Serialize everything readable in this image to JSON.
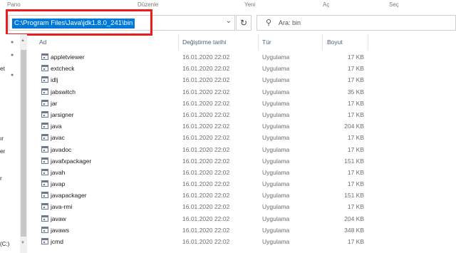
{
  "ribbon": {
    "pane": "Pano",
    "organize": "Düzenle",
    "new": "Yeni",
    "open": "Aç",
    "select": "Seç"
  },
  "address": {
    "path": "C:\\Program Files\\Java\\jdk1.8.0_241\\bin"
  },
  "search": {
    "placeholder": "Ara: bin"
  },
  "left_pane": {
    "labels": [
      "et",
      "ır",
      "er",
      "r",
      "(C:)"
    ]
  },
  "columns": {
    "name": "Ad",
    "date": "Değiştirme tarihi",
    "type": "Tür",
    "size": "Boyut"
  },
  "files": [
    {
      "name": "appletviewer",
      "date": "16.01.2020 22:02",
      "type": "Uygulama",
      "size": "17 KB"
    },
    {
      "name": "extcheck",
      "date": "16.01.2020 22:02",
      "type": "Uygulama",
      "size": "17 KB"
    },
    {
      "name": "idlj",
      "date": "16.01.2020 22:02",
      "type": "Uygulama",
      "size": "17 KB"
    },
    {
      "name": "jabswitch",
      "date": "16.01.2020 22:02",
      "type": "Uygulama",
      "size": "35 KB"
    },
    {
      "name": "jar",
      "date": "16.01.2020 22:02",
      "type": "Uygulama",
      "size": "17 KB"
    },
    {
      "name": "jarsigner",
      "date": "16.01.2020 22:02",
      "type": "Uygulama",
      "size": "17 KB"
    },
    {
      "name": "java",
      "date": "16.01.2020 22:02",
      "type": "Uygulama",
      "size": "204 KB"
    },
    {
      "name": "javac",
      "date": "16.01.2020 22:02",
      "type": "Uygulama",
      "size": "17 KB"
    },
    {
      "name": "javadoc",
      "date": "16.01.2020 22:02",
      "type": "Uygulama",
      "size": "17 KB"
    },
    {
      "name": "javafxpackager",
      "date": "16.01.2020 22:02",
      "type": "Uygulama",
      "size": "151 KB"
    },
    {
      "name": "javah",
      "date": "16.01.2020 22:02",
      "type": "Uygulama",
      "size": "17 KB"
    },
    {
      "name": "javap",
      "date": "16.01.2020 22:02",
      "type": "Uygulama",
      "size": "17 KB"
    },
    {
      "name": "javapackager",
      "date": "16.01.2020 22:02",
      "type": "Uygulama",
      "size": "151 KB"
    },
    {
      "name": "java-rmi",
      "date": "16.01.2020 22:02",
      "type": "Uygulama",
      "size": "17 KB"
    },
    {
      "name": "javaw",
      "date": "16.01.2020 22:02",
      "type": "Uygulama",
      "size": "204 KB"
    },
    {
      "name": "javaws",
      "date": "16.01.2020 22:02",
      "type": "Uygulama",
      "size": "348 KB"
    },
    {
      "name": "jcmd",
      "date": "16.01.2020 22:02",
      "type": "Uygulama",
      "size": "17 KB"
    }
  ],
  "colors": {
    "highlight": "#0078d7",
    "annotation": "#ea1c1c",
    "header_text": "#4c607a"
  },
  "icons": {
    "chevron": "chevron-down-icon",
    "refresh": "refresh-icon",
    "search": "search-icon",
    "pin": "pin-icon",
    "file": "application-icon"
  }
}
